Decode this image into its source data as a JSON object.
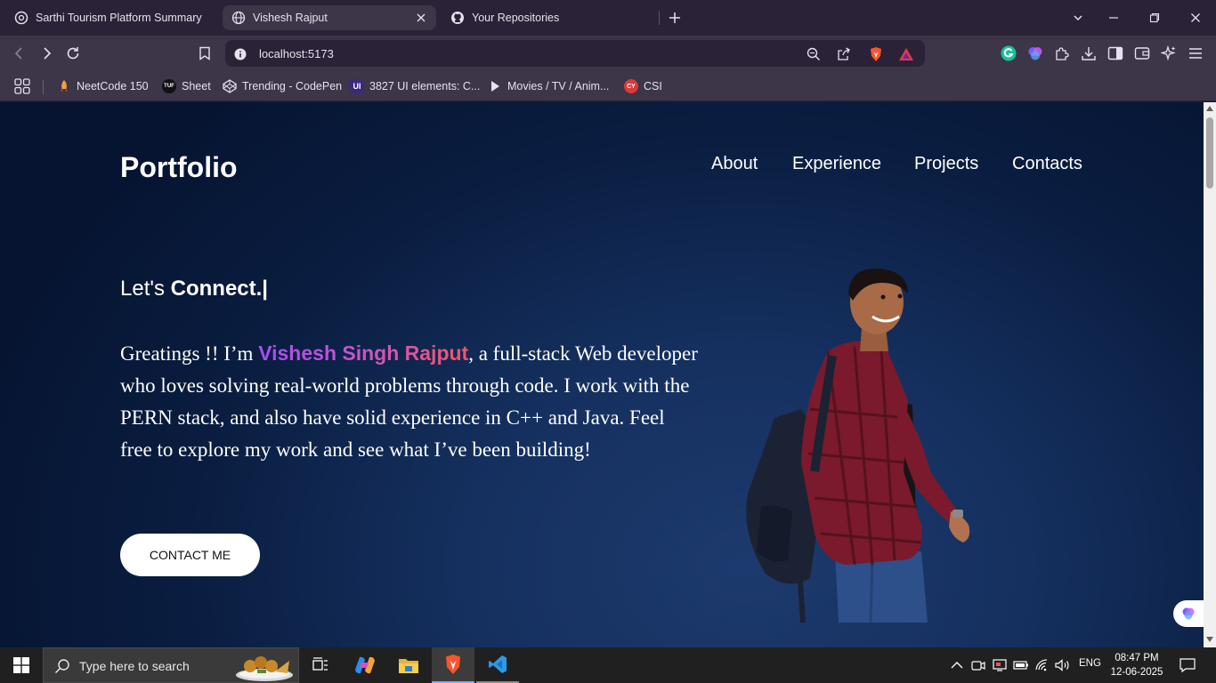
{
  "browser": {
    "tabs": [
      {
        "title": "Sarthi Tourism Platform Summary",
        "active": false
      },
      {
        "title": "Vishesh Rajput",
        "active": true
      },
      {
        "title": "Your Repositories",
        "active": false
      }
    ],
    "url": "localhost:5173",
    "bookmarks": [
      {
        "label": "NeetCode 150"
      },
      {
        "label": "Sheet",
        "icon_text": "TUF"
      },
      {
        "label": "Trending - CodePen"
      },
      {
        "label": "3827 UI elements: C...",
        "icon_text": "UI"
      },
      {
        "label": "Movies / TV / Anim..."
      },
      {
        "label": "CSI",
        "icon_text": "CY"
      }
    ]
  },
  "page": {
    "logo": "Portfolio",
    "nav": [
      "About",
      "Experience",
      "Projects",
      "Contacts"
    ],
    "heading_prefix": "Let's ",
    "heading_bold": "Connect.|",
    "intro_before": "Greatings !! I’m ",
    "intro_name": "Vishesh Singh Rajput",
    "intro_after": ", a full-stack Web developer who loves solving real-world problems through code. I work with the PERN stack, and also have solid experience in C++ and Java. Feel free to explore my work and see what I’ve been building!",
    "cta_label": "CONTACT ME"
  },
  "taskbar": {
    "search_placeholder": "Type here to search",
    "language": "ENG",
    "time": "08:47 PM",
    "date": "12-06-2025"
  },
  "colors": {
    "page_bg_dark": "#061431",
    "page_bg_light": "#1d3a6e",
    "name_gradient_start": "#a44ef6",
    "name_gradient_end": "#f0566b",
    "browser_frame": "#3d3548",
    "taskbar": "#202020"
  }
}
